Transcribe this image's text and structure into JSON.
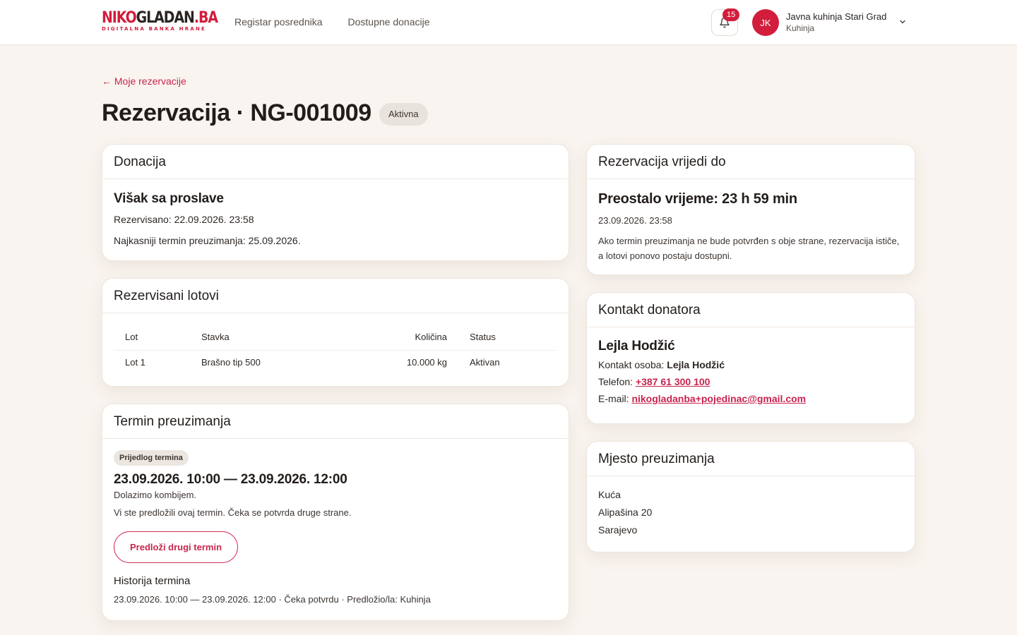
{
  "brand": {
    "logo_red": "NIKO",
    "logo_dark": "GLADAN",
    "logo_red2": ".BA",
    "tagline": "DIGITALNA BANKA HRANE"
  },
  "nav": {
    "items": [
      {
        "label": "Registar posrednika"
      },
      {
        "label": "Dostupne donacije"
      }
    ]
  },
  "notifications": {
    "count": "15"
  },
  "user": {
    "initials": "JK",
    "name": "Javna kuhinja Stari Grad",
    "role": "Kuhinja"
  },
  "back_link": "← Moje rezervacije",
  "page": {
    "title": "Rezervacija · NG-001009",
    "status": "Aktivna"
  },
  "donation": {
    "header": "Donacija",
    "name": "Višak sa proslave",
    "reserved": "Rezervisano: 22.09.2026. 23:58",
    "deadline": "Najkasniji termin preuzimanja: 25.09.2026."
  },
  "lots": {
    "header": "Rezervisani lotovi",
    "columns": [
      "Lot",
      "Stavka",
      "Količina",
      "Status"
    ],
    "rows": [
      [
        "Lot 1",
        "Brašno tip 500",
        "10.000 kg",
        "Aktivan"
      ]
    ]
  },
  "pickup": {
    "header": "Termin preuzimanja",
    "chip": "Prijedlog termina",
    "range": "23.09.2026. 10:00 — 23.09.2026. 12:00",
    "note": "Dolazimo kombijem.",
    "info": "Vi ste predložili ovaj termin. Čeka se potvrda druge strane.",
    "button": "Predloži drugi termin",
    "history_title": "Historija termina",
    "history_item": "23.09.2026. 10:00 — 23.09.2026. 12:00 · Čeka potvrdu · Predložio/la: Kuhinja"
  },
  "validity": {
    "header": "Rezervacija vrijedi do",
    "remaining": "Preostalo vrijeme: 23 h 59 min",
    "datetime": "23.09.2026. 23:58",
    "info": "Ako termin preuzimanja ne bude potvrđen s obje strane, rezervacija ističe, a lotovi ponovo postaju dostupni."
  },
  "contact": {
    "header": "Kontakt donatora",
    "name": "Lejla Hodžić",
    "person_label": "Kontakt osoba: ",
    "person": "Lejla Hodžić",
    "phone_label": "Telefon: ",
    "phone": "+387 61 300 100",
    "email_label": "E-mail: ",
    "email": "nikogladanba+pojedinac@gmail.com"
  },
  "location": {
    "header": "Mjesto preuzimanja",
    "lines": [
      "Kuća",
      "Alipašina 20",
      "Sarajevo"
    ]
  },
  "colors": {
    "accent": "#d21d3c",
    "background": "#f9f4ef"
  },
  "icons": {
    "notifications": "bell-icon",
    "user_menu": "chevron-down-icon"
  }
}
